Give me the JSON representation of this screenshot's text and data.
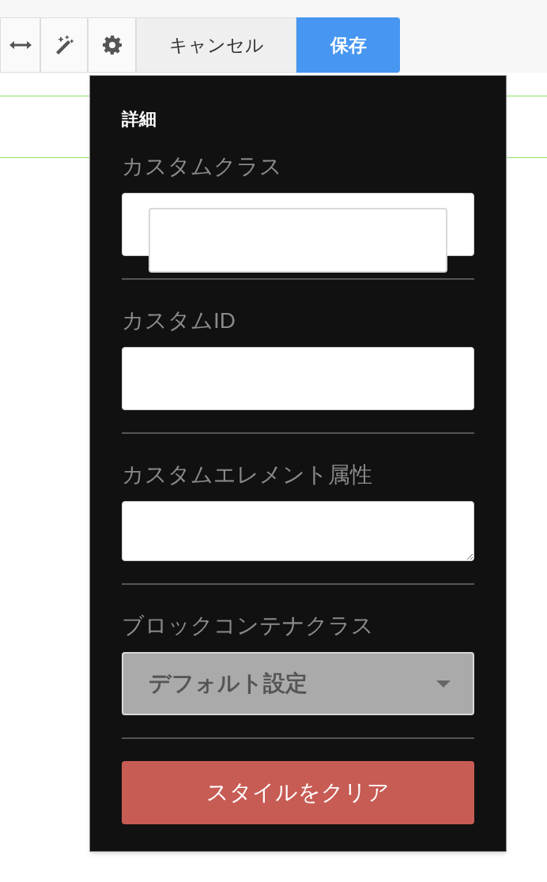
{
  "toolbar": {
    "tools": [
      {
        "kind": "resize"
      },
      {
        "kind": "magic"
      },
      {
        "kind": "settings"
      }
    ],
    "cancel": "キャンセル",
    "save": "保存"
  },
  "panel": {
    "title": "詳細",
    "fields": [
      {
        "label": "カスタムクラス",
        "kind": "text",
        "overlay": true
      },
      {
        "label": "カスタムID",
        "kind": "text",
        "overlay": false
      },
      {
        "label": "カスタムエレメント属性",
        "kind": "textarea",
        "overlay": false
      },
      {
        "label": "ブロックコンテナクラス",
        "kind": "select",
        "value": "デフォルト設定",
        "overlay": false
      }
    ],
    "clear_button": "スタイルをクリア"
  }
}
